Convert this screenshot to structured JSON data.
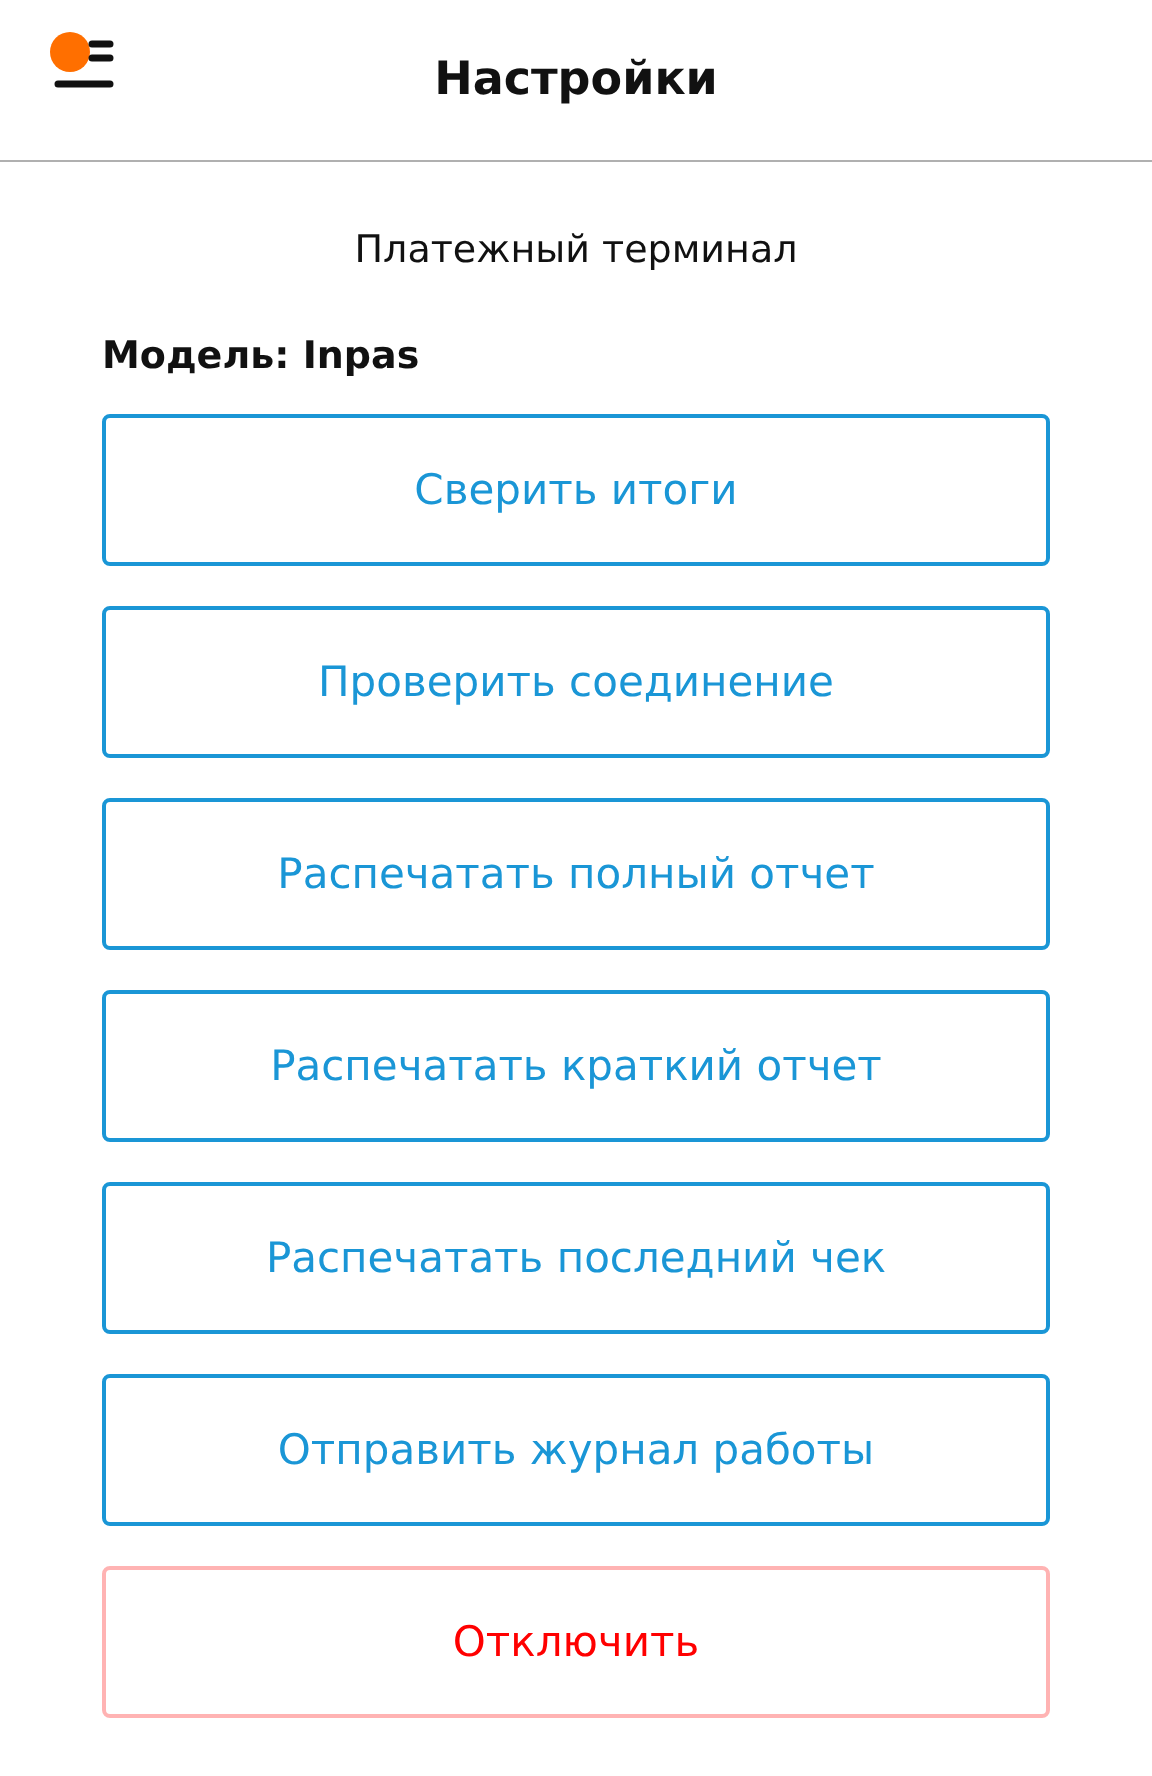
{
  "header": {
    "title": "Настройки"
  },
  "section_title": "Платежный терминал",
  "model": {
    "label": "Модель:",
    "value": "Inpas"
  },
  "buttons": [
    {
      "label": "Сверить итоги",
      "kind": "action"
    },
    {
      "label": "Проверить соединение",
      "kind": "action"
    },
    {
      "label": "Распечатать полный отчет",
      "kind": "action"
    },
    {
      "label": "Распечатать краткий отчет",
      "kind": "action"
    },
    {
      "label": "Распечатать последний чек",
      "kind": "action"
    },
    {
      "label": "Отправить журнал работы",
      "kind": "action"
    },
    {
      "label": "Отключить",
      "kind": "danger"
    }
  ]
}
